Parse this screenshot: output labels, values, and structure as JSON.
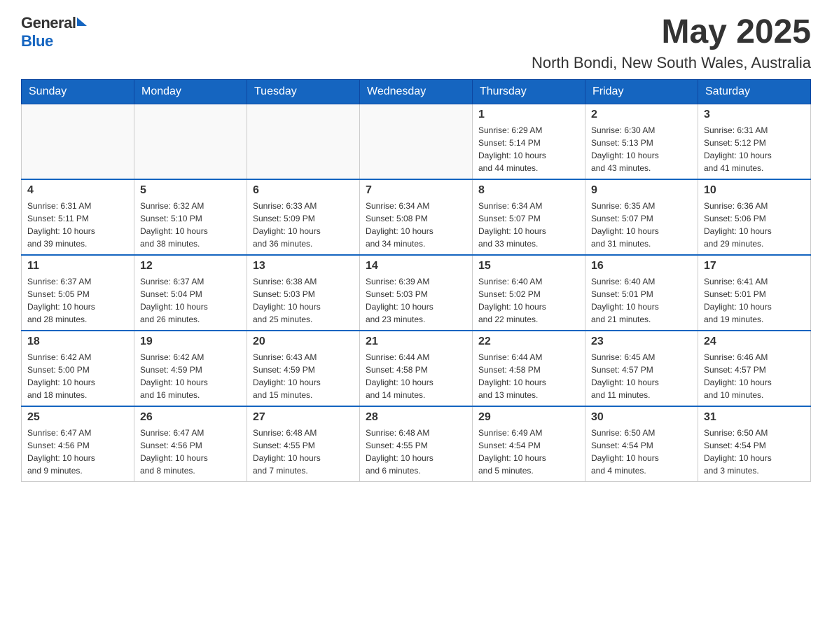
{
  "header": {
    "logo_general": "General",
    "logo_blue": "Blue",
    "month_year": "May 2025",
    "location": "North Bondi, New South Wales, Australia"
  },
  "calendar": {
    "days_of_week": [
      "Sunday",
      "Monday",
      "Tuesday",
      "Wednesday",
      "Thursday",
      "Friday",
      "Saturday"
    ],
    "weeks": [
      [
        {
          "day": "",
          "info": ""
        },
        {
          "day": "",
          "info": ""
        },
        {
          "day": "",
          "info": ""
        },
        {
          "day": "",
          "info": ""
        },
        {
          "day": "1",
          "info": "Sunrise: 6:29 AM\nSunset: 5:14 PM\nDaylight: 10 hours\nand 44 minutes."
        },
        {
          "day": "2",
          "info": "Sunrise: 6:30 AM\nSunset: 5:13 PM\nDaylight: 10 hours\nand 43 minutes."
        },
        {
          "day": "3",
          "info": "Sunrise: 6:31 AM\nSunset: 5:12 PM\nDaylight: 10 hours\nand 41 minutes."
        }
      ],
      [
        {
          "day": "4",
          "info": "Sunrise: 6:31 AM\nSunset: 5:11 PM\nDaylight: 10 hours\nand 39 minutes."
        },
        {
          "day": "5",
          "info": "Sunrise: 6:32 AM\nSunset: 5:10 PM\nDaylight: 10 hours\nand 38 minutes."
        },
        {
          "day": "6",
          "info": "Sunrise: 6:33 AM\nSunset: 5:09 PM\nDaylight: 10 hours\nand 36 minutes."
        },
        {
          "day": "7",
          "info": "Sunrise: 6:34 AM\nSunset: 5:08 PM\nDaylight: 10 hours\nand 34 minutes."
        },
        {
          "day": "8",
          "info": "Sunrise: 6:34 AM\nSunset: 5:07 PM\nDaylight: 10 hours\nand 33 minutes."
        },
        {
          "day": "9",
          "info": "Sunrise: 6:35 AM\nSunset: 5:07 PM\nDaylight: 10 hours\nand 31 minutes."
        },
        {
          "day": "10",
          "info": "Sunrise: 6:36 AM\nSunset: 5:06 PM\nDaylight: 10 hours\nand 29 minutes."
        }
      ],
      [
        {
          "day": "11",
          "info": "Sunrise: 6:37 AM\nSunset: 5:05 PM\nDaylight: 10 hours\nand 28 minutes."
        },
        {
          "day": "12",
          "info": "Sunrise: 6:37 AM\nSunset: 5:04 PM\nDaylight: 10 hours\nand 26 minutes."
        },
        {
          "day": "13",
          "info": "Sunrise: 6:38 AM\nSunset: 5:03 PM\nDaylight: 10 hours\nand 25 minutes."
        },
        {
          "day": "14",
          "info": "Sunrise: 6:39 AM\nSunset: 5:03 PM\nDaylight: 10 hours\nand 23 minutes."
        },
        {
          "day": "15",
          "info": "Sunrise: 6:40 AM\nSunset: 5:02 PM\nDaylight: 10 hours\nand 22 minutes."
        },
        {
          "day": "16",
          "info": "Sunrise: 6:40 AM\nSunset: 5:01 PM\nDaylight: 10 hours\nand 21 minutes."
        },
        {
          "day": "17",
          "info": "Sunrise: 6:41 AM\nSunset: 5:01 PM\nDaylight: 10 hours\nand 19 minutes."
        }
      ],
      [
        {
          "day": "18",
          "info": "Sunrise: 6:42 AM\nSunset: 5:00 PM\nDaylight: 10 hours\nand 18 minutes."
        },
        {
          "day": "19",
          "info": "Sunrise: 6:42 AM\nSunset: 4:59 PM\nDaylight: 10 hours\nand 16 minutes."
        },
        {
          "day": "20",
          "info": "Sunrise: 6:43 AM\nSunset: 4:59 PM\nDaylight: 10 hours\nand 15 minutes."
        },
        {
          "day": "21",
          "info": "Sunrise: 6:44 AM\nSunset: 4:58 PM\nDaylight: 10 hours\nand 14 minutes."
        },
        {
          "day": "22",
          "info": "Sunrise: 6:44 AM\nSunset: 4:58 PM\nDaylight: 10 hours\nand 13 minutes."
        },
        {
          "day": "23",
          "info": "Sunrise: 6:45 AM\nSunset: 4:57 PM\nDaylight: 10 hours\nand 11 minutes."
        },
        {
          "day": "24",
          "info": "Sunrise: 6:46 AM\nSunset: 4:57 PM\nDaylight: 10 hours\nand 10 minutes."
        }
      ],
      [
        {
          "day": "25",
          "info": "Sunrise: 6:47 AM\nSunset: 4:56 PM\nDaylight: 10 hours\nand 9 minutes."
        },
        {
          "day": "26",
          "info": "Sunrise: 6:47 AM\nSunset: 4:56 PM\nDaylight: 10 hours\nand 8 minutes."
        },
        {
          "day": "27",
          "info": "Sunrise: 6:48 AM\nSunset: 4:55 PM\nDaylight: 10 hours\nand 7 minutes."
        },
        {
          "day": "28",
          "info": "Sunrise: 6:48 AM\nSunset: 4:55 PM\nDaylight: 10 hours\nand 6 minutes."
        },
        {
          "day": "29",
          "info": "Sunrise: 6:49 AM\nSunset: 4:54 PM\nDaylight: 10 hours\nand 5 minutes."
        },
        {
          "day": "30",
          "info": "Sunrise: 6:50 AM\nSunset: 4:54 PM\nDaylight: 10 hours\nand 4 minutes."
        },
        {
          "day": "31",
          "info": "Sunrise: 6:50 AM\nSunset: 4:54 PM\nDaylight: 10 hours\nand 3 minutes."
        }
      ]
    ]
  }
}
